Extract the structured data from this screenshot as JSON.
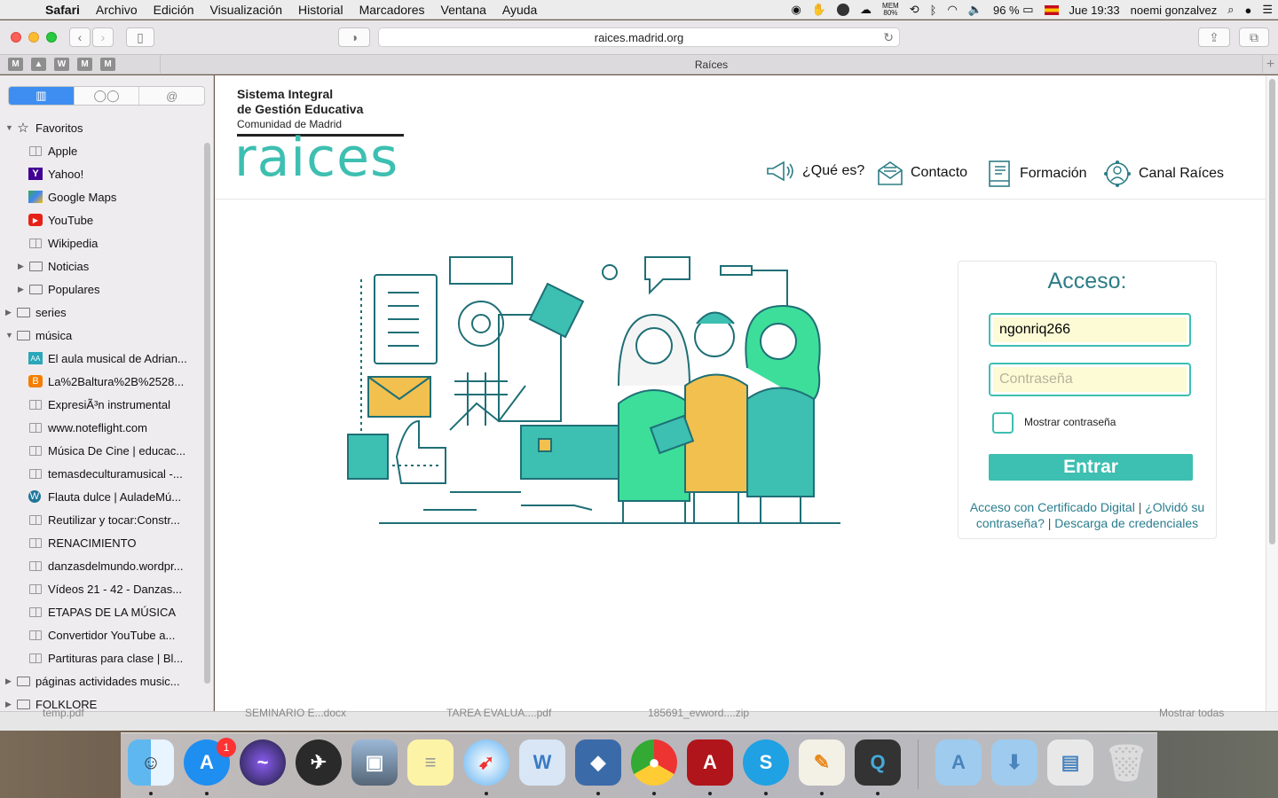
{
  "menubar": {
    "app": "Safari",
    "items": [
      "Archivo",
      "Edición",
      "Visualización",
      "Historial",
      "Marcadores",
      "Ventana",
      "Ayuda"
    ],
    "mem_top": "MEM",
    "mem_bottom": "80%",
    "battery": "96 %",
    "clock": "Jue 19:33",
    "user": "noemi gonzalvez"
  },
  "toolbar": {
    "url": "raices.madrid.org"
  },
  "tab": {
    "title": "Raíces",
    "pinned": [
      "M",
      "",
      "W",
      "M",
      "M"
    ]
  },
  "sidebar": {
    "items": [
      {
        "label": "Favoritos",
        "level": 0,
        "type": "star",
        "disclosure": "open"
      },
      {
        "label": "Apple",
        "level": 1,
        "type": "book"
      },
      {
        "label": "Yahoo!",
        "level": 1,
        "type": "yahoo"
      },
      {
        "label": "Google Maps",
        "level": 1,
        "type": "maps"
      },
      {
        "label": "YouTube",
        "level": 1,
        "type": "youtube"
      },
      {
        "label": "Wikipedia",
        "level": 1,
        "type": "book"
      },
      {
        "label": "Noticias",
        "level": 1,
        "type": "folder",
        "disclosure": "closed"
      },
      {
        "label": "Populares",
        "level": 1,
        "type": "folder",
        "disclosure": "closed"
      },
      {
        "label": "series",
        "level": 0,
        "type": "folder",
        "disclosure": "closed"
      },
      {
        "label": "música",
        "level": 0,
        "type": "folder",
        "disclosure": "open"
      },
      {
        "label": "El aula musical de Adrian...",
        "level": 1,
        "type": "aa"
      },
      {
        "label": "La%2Baltura%2B%2528...",
        "level": 1,
        "type": "blogger"
      },
      {
        "label": "ExpresiÃ³n instrumental",
        "level": 1,
        "type": "book"
      },
      {
        "label": "www.noteflight.com",
        "level": 1,
        "type": "book"
      },
      {
        "label": "Música De Cine | educac...",
        "level": 1,
        "type": "book"
      },
      {
        "label": "temasdeculturamusical -...",
        "level": 1,
        "type": "book"
      },
      {
        "label": "Flauta dulce | AuladeMú...",
        "level": 1,
        "type": "wordpress"
      },
      {
        "label": "Reutilizar y tocar:Constr...",
        "level": 1,
        "type": "book"
      },
      {
        "label": "RENACIMIENTO",
        "level": 1,
        "type": "book"
      },
      {
        "label": "danzasdelmundo.wordpr...",
        "level": 1,
        "type": "book"
      },
      {
        "label": "Vídeos 21 - 42 - Danzas...",
        "level": 1,
        "type": "book"
      },
      {
        "label": "ETAPAS DE LA MÚSICA",
        "level": 1,
        "type": "book"
      },
      {
        "label": "Convertidor YouTube a...",
        "level": 1,
        "type": "book"
      },
      {
        "label": "Partituras para clase | Bl...",
        "level": 1,
        "type": "book"
      },
      {
        "label": "páginas actividades music...",
        "level": 0,
        "type": "folder",
        "disclosure": "closed"
      },
      {
        "label": "FOLKLORE",
        "level": 0,
        "type": "folder",
        "disclosure": "closed"
      }
    ]
  },
  "site": {
    "logo_line1": "Sistema Integral",
    "logo_line2": "de Gestión Educativa",
    "logo_sub": "Comunidad de Madrid",
    "logo_word": "raices",
    "nav": [
      "¿Qué es?",
      "Contacto",
      "Formación",
      "Canal Raíces"
    ]
  },
  "login": {
    "title": "Acceso:",
    "username": "ngonriq266",
    "password_placeholder": "Contraseña",
    "show_password": "Mostrar contraseña",
    "submit": "Entrar",
    "link_cert": "Acceso con Certificado Digital",
    "link_forgot": "¿Olvidó su contraseña?",
    "link_download": "Descarga de credenciales",
    "separator": "|"
  },
  "downloads": [
    "temp.pdf",
    "SEMINARIO E...docx",
    "TAREA EVALUA....pdf",
    "185691_evword....zip",
    "Mostrar todas"
  ],
  "dock": {
    "appstore_badge": "1"
  },
  "colors": {
    "brand_teal": "#3dbfb1",
    "title_teal": "#2d7d86",
    "link_blue": "#2a7d8e",
    "input_fill": "#fcfbd6"
  }
}
